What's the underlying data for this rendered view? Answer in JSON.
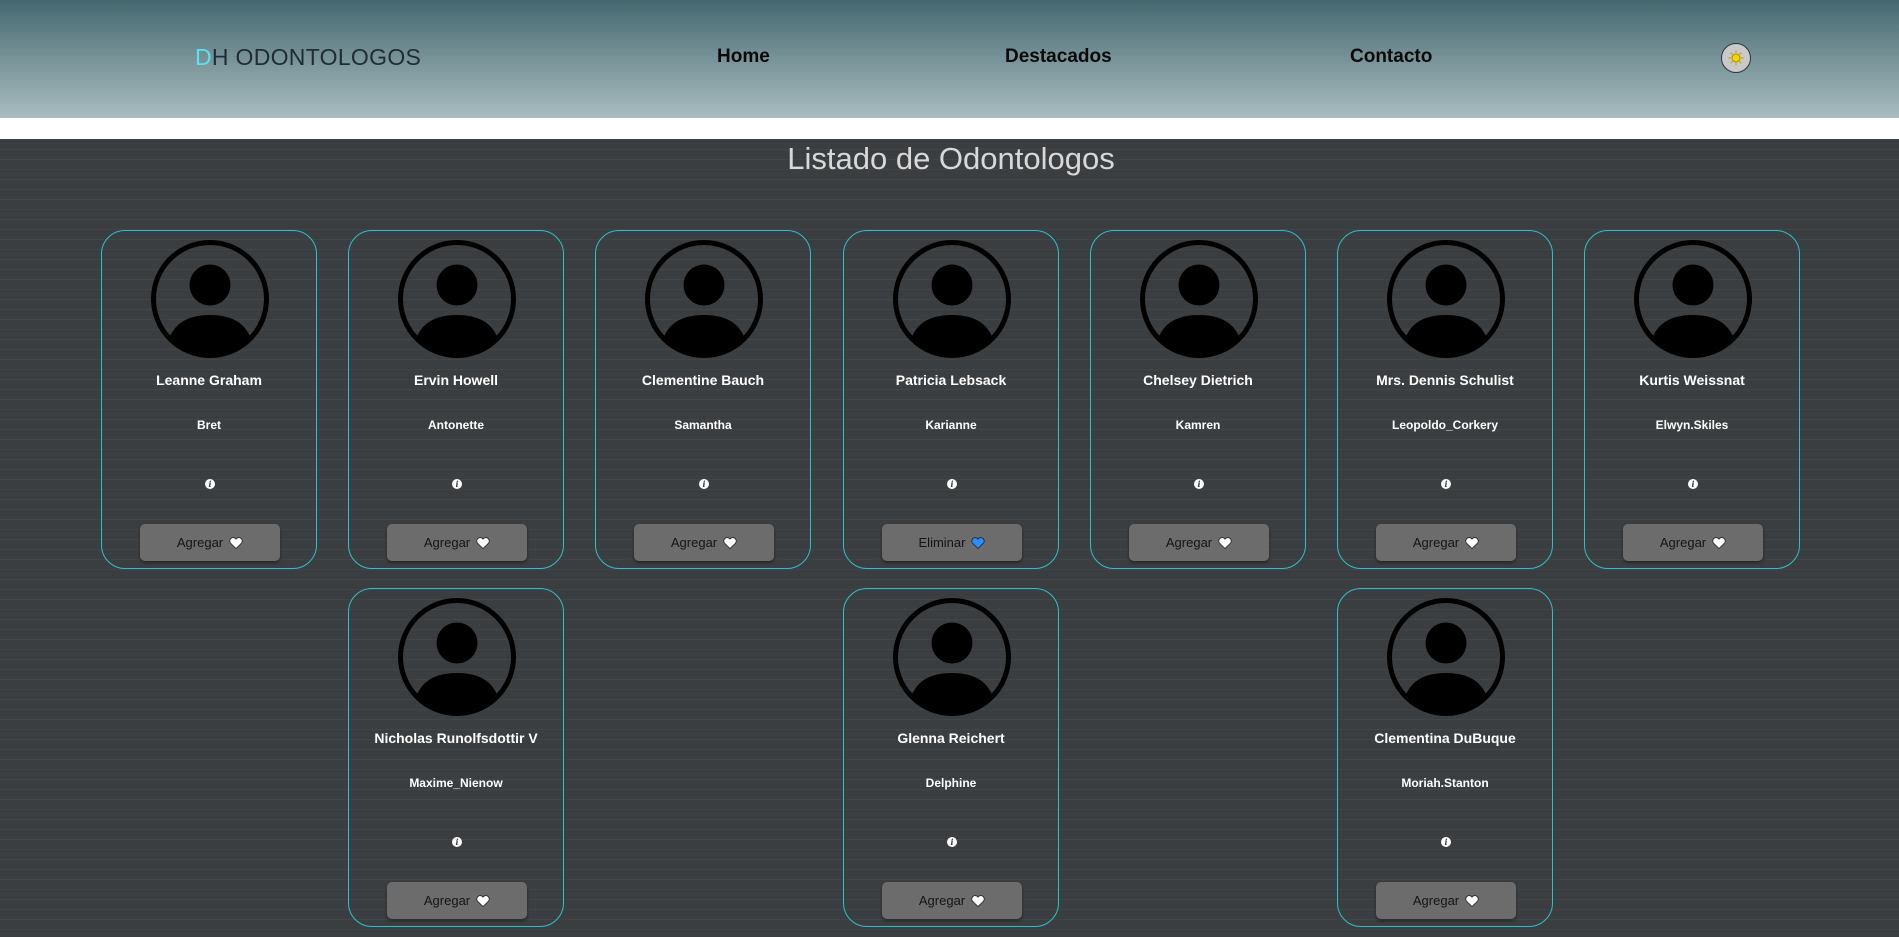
{
  "header": {
    "logo_first": "D",
    "logo_rest": "H ODONTOLOGOS",
    "nav": [
      {
        "label": "Home"
      },
      {
        "label": "Destacados"
      },
      {
        "label": "Contacto"
      }
    ],
    "theme_icon": "sun-icon"
  },
  "main": {
    "title": "Listado de Odontologos",
    "cards": [
      {
        "name": "Leanne Graham",
        "username": "Bret",
        "button": "Agregar",
        "favorite": false
      },
      {
        "name": "Ervin Howell",
        "username": "Antonette",
        "button": "Agregar",
        "favorite": false
      },
      {
        "name": "Clementine Bauch",
        "username": "Samantha",
        "button": "Agregar",
        "favorite": false
      },
      {
        "name": "Patricia Lebsack",
        "username": "Karianne",
        "button": "Eliminar",
        "favorite": true
      },
      {
        "name": "Chelsey Dietrich",
        "username": "Kamren",
        "button": "Agregar",
        "favorite": false
      },
      {
        "name": "Mrs. Dennis Schulist",
        "username": "Leopoldo_Corkery",
        "button": "Agregar",
        "favorite": false
      },
      {
        "name": "Kurtis Weissnat",
        "username": "Elwyn.Skiles",
        "button": "Agregar",
        "favorite": false
      },
      {
        "name": "Nicholas Runolfsdottir V",
        "username": "Maxime_Nienow",
        "button": "Agregar",
        "favorite": false
      },
      {
        "name": "Glenna Reichert",
        "username": "Delphine",
        "button": "Agregar",
        "favorite": false
      },
      {
        "name": "Clementina DuBuque",
        "username": "Moriah.Stanton",
        "button": "Agregar",
        "favorite": false
      }
    ],
    "icons": {
      "avatar": "user-avatar-icon",
      "info": "info-icon",
      "heart": "heart-icon"
    },
    "colors": {
      "card_border": "#2ec0c8",
      "heart_default": "#ffffff",
      "heart_favorite": "#2a8cff",
      "logo_accent": "#5ee0ee"
    }
  }
}
